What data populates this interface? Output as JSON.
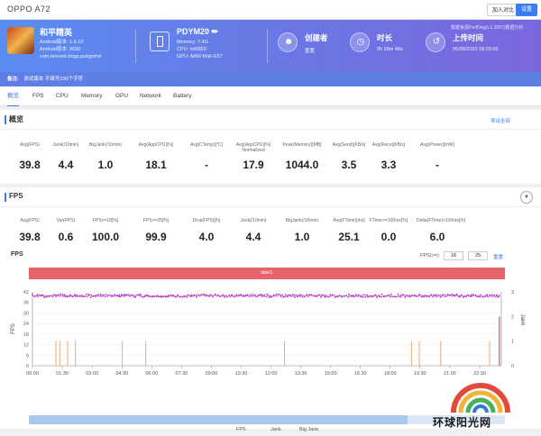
{
  "window": {
    "title": "OPPO A72",
    "compare_label": "加入对比",
    "settings_label": "设置"
  },
  "app": {
    "name": "和平精英",
    "android_version": "Android版本: 1.6.10",
    "android_build": "Android版本: 9630",
    "package": "com.tencent.tmgp.pubgmhd"
  },
  "device": {
    "name": "PDYM20 ✏",
    "memory": "Memory: 7.4G",
    "cpu": "CPU: mt6853",
    "gpu": "GPU: ARM Mali-G57"
  },
  "stats": [
    {
      "label": "创建者",
      "value": "重置",
      "icon": "user-icon"
    },
    {
      "label": "时长",
      "value": "0h 28m 48s",
      "icon": "clock-icon"
    },
    {
      "label": "上传时间",
      "value": "05/08/2020 18:20:59",
      "icon": "history-icon"
    }
  ],
  "hero_note": "数据来源PerfDog(v.1.2007)数据分析",
  "remark": {
    "label": "备注:",
    "text": "测试版本   不填写100个字符"
  },
  "tabs": [
    "概览",
    "FPS",
    "CPU",
    "Memory",
    "GPU",
    "Network",
    "Battery"
  ],
  "overview": {
    "title": "概览",
    "expand_label": "导出全部",
    "metrics": [
      {
        "label": "Avg(FPS)",
        "value": "39.8"
      },
      {
        "label": "Jank(/10min)",
        "value": "4.4"
      },
      {
        "label": "BigJank(/10min)",
        "value": "1.0"
      },
      {
        "label": "Avg(AppCPU)[%]",
        "value": "18.1"
      },
      {
        "label": "Avg(CTemp)[°C]",
        "value": "-"
      },
      {
        "label": "Avg(AppCPU)[%] Normalized",
        "value": "17.9"
      },
      {
        "label": "Peak(Memory)[MB]",
        "value": "1044.0"
      },
      {
        "label": "Avg(Send)[KB/s]",
        "value": "3.5"
      },
      {
        "label": "Avg(Recv)[KB/s]",
        "value": "3.3"
      },
      {
        "label": "Avg(Power)[mW]",
        "value": "-"
      }
    ]
  },
  "fps_section": {
    "title": "FPS",
    "metrics": [
      {
        "label": "Avg(FPS)",
        "value": "39.8"
      },
      {
        "label": "Var(FPS)",
        "value": "0.6"
      },
      {
        "label": "FPS>=18[%]",
        "value": "100.0"
      },
      {
        "label": "FPS>=25[%]",
        "value": "99.9"
      },
      {
        "label": "Drop(FPS)[/h]",
        "value": "4.0"
      },
      {
        "label": "Jank(/10min)",
        "value": "4.4"
      },
      {
        "label": "BigJank(/10min)",
        "value": "1.0"
      },
      {
        "label": "Avg(FTime)[ms]",
        "value": "25.1"
      },
      {
        "label": "FTime>=100ms[%]",
        "value": "0.0"
      },
      {
        "label": "Delta(FTime)>100ms[/h]",
        "value": "6.0"
      }
    ]
  },
  "chart_toolbar": {
    "title": "FPS",
    "filter_label": "FPS(>=)",
    "filter_value_1": "18",
    "filter_value_2": "25",
    "reset_label": "重置",
    "band_label": "label1"
  },
  "legend": [
    "FPS",
    "Jank",
    "Big Jank"
  ],
  "watermark_text": "环球阳光网",
  "colors": {
    "fps": "#b53ac0",
    "jank": "#e8a16a",
    "bigjank": "#c04848",
    "accent": "#3d7bf5",
    "band": "#e8646b"
  },
  "chart_data": {
    "type": "line",
    "ylabel": "FPS",
    "y2label": "Jank",
    "ylim": [
      0,
      42
    ],
    "y2lim": [
      0,
      3
    ],
    "yticks": [
      0,
      6,
      12,
      18,
      24,
      30,
      36,
      42
    ],
    "y2ticks": [
      0,
      1,
      2,
      3
    ],
    "xticks": [
      "00:00",
      "01:30",
      "03:00",
      "04:30",
      "06:00",
      "07:30",
      "09:00",
      "10:30",
      "12:00",
      "13:30",
      "15:00",
      "16:30",
      "18:00",
      "19:30",
      "21:00",
      "22:30"
    ],
    "x_range_min": [
      0,
      24
    ],
    "fps_level": 39.8,
    "jank_times_min": [
      1.2,
      1.4,
      1.8,
      2.2,
      4.6,
      5.8,
      12.9,
      19.4,
      19.8,
      20.9,
      23.4
    ],
    "jank_value": 1,
    "bigjank_times_min": [
      23.9
    ],
    "bigjank_value": 2
  }
}
